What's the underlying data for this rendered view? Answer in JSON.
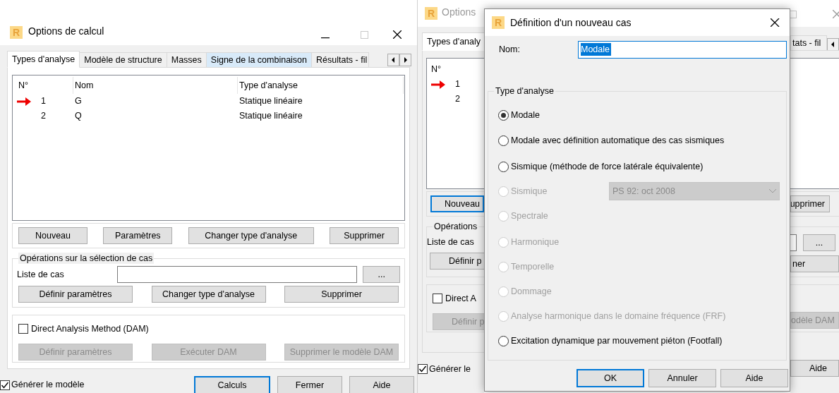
{
  "main_window": {
    "logo_letter": "R",
    "title": "Options de calcul",
    "tabs": [
      {
        "label": "Types d'analyse",
        "selected": true,
        "hovered": false
      },
      {
        "label": "Modèle de structure",
        "selected": false,
        "hovered": false
      },
      {
        "label": "Masses",
        "selected": false,
        "hovered": false
      },
      {
        "label": "Signe de la combinaison",
        "selected": false,
        "hovered": true
      },
      {
        "label": "Résultats - fil",
        "selected": false,
        "hovered": false
      }
    ],
    "columns": [
      "N°",
      "Nom",
      "Type d'analyse"
    ],
    "rows": [
      {
        "number": "1",
        "name": "G",
        "analysis_type": "Statique linéaire",
        "current": true
      },
      {
        "number": "2",
        "name": "Q",
        "analysis_type": "Statique linéaire",
        "current": false
      }
    ],
    "action_buttons": [
      "Nouveau",
      "Paramètres",
      "Changer type d'analyse",
      "Supprimer"
    ],
    "selection_group": {
      "title": "Opérations sur la sélection de cas",
      "list_label": "Liste de cas",
      "browse_button": "...",
      "buttons": [
        "Définir paramètres",
        "Changer type d'analyse",
        "Supprimer"
      ]
    },
    "dam": {
      "label": "Direct Analysis Method (DAM)",
      "checked": false,
      "buttons": [
        {
          "label": "Définir paramètres",
          "disabled": true
        },
        {
          "label": "Exécuter DAM",
          "disabled": true
        },
        {
          "label": "Supprimer le modèle DAM",
          "disabled": true
        }
      ]
    },
    "generate_model": {
      "label": "Générer le modèle",
      "checked": true
    },
    "footer_buttons": [
      {
        "label": "Calculs",
        "default": true
      },
      {
        "label": "Fermer",
        "default": false
      },
      {
        "label": "Aide",
        "default": false
      }
    ]
  },
  "background_window": {
    "logo_letter": "R",
    "title": "Options",
    "tab_left": "Types d'analy",
    "tab_right": "tats - fil",
    "column": "N°",
    "rows": [
      {
        "number": "1",
        "current": true
      },
      {
        "number": "2",
        "current": false
      }
    ],
    "new_button": {
      "label": "Nouveau",
      "default": true
    },
    "delete_button": "upprimer",
    "group_title": "Opérations",
    "list_label": "Liste de cas",
    "browse_button": "...",
    "define_button": "Définir p",
    "change_button": "ner",
    "dam": {
      "label": "Direct A",
      "checked": false,
      "define_button": "Définir p",
      "delete_button": "odèle DAM",
      "disabled": true
    },
    "generate_model": {
      "label": "Générer le",
      "checked": true
    },
    "help_button": "Aide"
  },
  "dialog": {
    "logo_letter": "R",
    "title": "Définition d'un nouveau cas",
    "name_label": "Nom:",
    "name_value": "Modale",
    "group_title": "Type d'analyse",
    "options": [
      {
        "kind": "radio",
        "label": "Modale",
        "selected": true,
        "disabled": false
      },
      {
        "kind": "radio",
        "label": "Modale avec définition automatique des cas sismiques",
        "selected": false,
        "disabled": false
      },
      {
        "kind": "radio",
        "label": "Sismique (méthode de force latérale équivalente)",
        "selected": false,
        "disabled": false
      },
      {
        "kind": "radio_combo",
        "label": "Sismique",
        "selected": false,
        "disabled": true,
        "combo_value": "PS 92: oct 2008"
      },
      {
        "kind": "radio",
        "label": "Spectrale",
        "selected": false,
        "disabled": true
      },
      {
        "kind": "radio",
        "label": "Harmonique",
        "selected": false,
        "disabled": true
      },
      {
        "kind": "radio",
        "label": "Temporelle",
        "selected": false,
        "disabled": true
      },
      {
        "kind": "radio",
        "label": "Dommage",
        "selected": false,
        "disabled": true
      },
      {
        "kind": "radio",
        "label": "Analyse harmonique dans le domaine fréquence (FRF)",
        "selected": false,
        "disabled": true
      },
      {
        "kind": "radio",
        "label": "Excitation dynamique par mouvement piéton (Footfall)",
        "selected": false,
        "disabled": false
      }
    ],
    "buttons": [
      {
        "label": "OK",
        "default": true
      },
      {
        "label": "Annuler",
        "default": false
      },
      {
        "label": "Aide",
        "default": false
      }
    ]
  }
}
